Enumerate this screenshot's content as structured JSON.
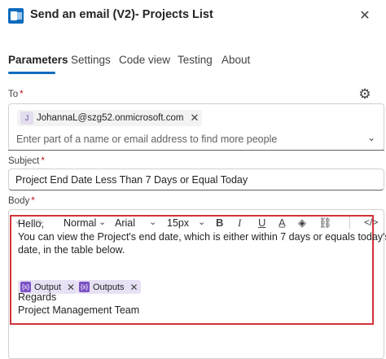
{
  "header": {
    "title": "Send an email (V2)- Projects List",
    "close_glyph": "✕"
  },
  "tabs": [
    {
      "label": "Parameters",
      "active": true
    },
    {
      "label": "Settings",
      "active": false
    },
    {
      "label": "Code view",
      "active": false
    },
    {
      "label": "Testing",
      "active": false
    },
    {
      "label": "About",
      "active": false
    }
  ],
  "to": {
    "label": "To",
    "required": "*",
    "recipient": {
      "initial": "J",
      "email": "JohannaL@szg52.onmicrosoft.com"
    },
    "placeholder": "Enter part of a name or email address to find more people"
  },
  "subject": {
    "label": "Subject",
    "required": "*",
    "value": "Project End Date Less Than 7 Days or Equal Today"
  },
  "body": {
    "label": "Body",
    "required": "*",
    "toolbar": {
      "style": "Normal",
      "font": "Arial",
      "size": "15px"
    },
    "lines": [
      "Hello,",
      "You can view the Project's end date, which is either within 7 days or equals today's",
      "date, in the table below."
    ],
    "tokens": [
      {
        "label": "Output",
        "icon": "{x}"
      },
      {
        "label": "Outputs",
        "icon": "{x}"
      }
    ],
    "closing": [
      "Regards",
      "Project Management Team"
    ]
  },
  "colors": {
    "accent": "#0f6cbd",
    "editor_border": "#d13438",
    "token_bg": "#e8e1f5",
    "token_icon": "#7b51c4"
  }
}
